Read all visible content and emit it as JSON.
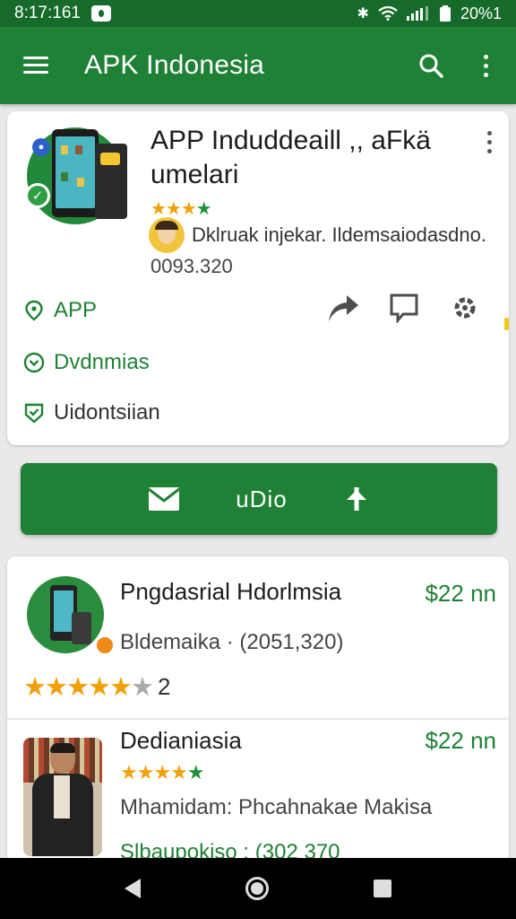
{
  "status_bar": {
    "time": "8:17:161",
    "right_text": "20%1"
  },
  "app_bar": {
    "title": "APK Indonesia"
  },
  "app_detail": {
    "name": "APP Induddeaill ,, aFkä umelari",
    "dev_name": "Dklruak injekar. Ildemsaiodasdno.",
    "count": "0093.320",
    "meta": [
      {
        "label": "APP",
        "icon": "location-pin-icon"
      },
      {
        "label": "Dvdnmias",
        "icon": "chevron-circle-icon"
      },
      {
        "label": "Uidontsiian",
        "icon": "shield-check-icon"
      }
    ]
  },
  "install_button": {
    "label": "uDio"
  },
  "list": [
    {
      "title": "Pngdasrial Hdorlmsia",
      "price": "$22 nn",
      "subtitle": "Bldemaika · (2051,320)",
      "rating_number": "2",
      "rating": 4.5
    },
    {
      "title": "Dedianiasia",
      "price": "$22 nn",
      "subtitle": "Mhamidam: Phcahnakae Makisa",
      "subtitle2": "Slbaupokiso : (302 370",
      "rating": 4
    }
  ],
  "colors": {
    "primary": "#1f8136",
    "primary_dark": "#166b2b",
    "star": "#f2a007"
  }
}
